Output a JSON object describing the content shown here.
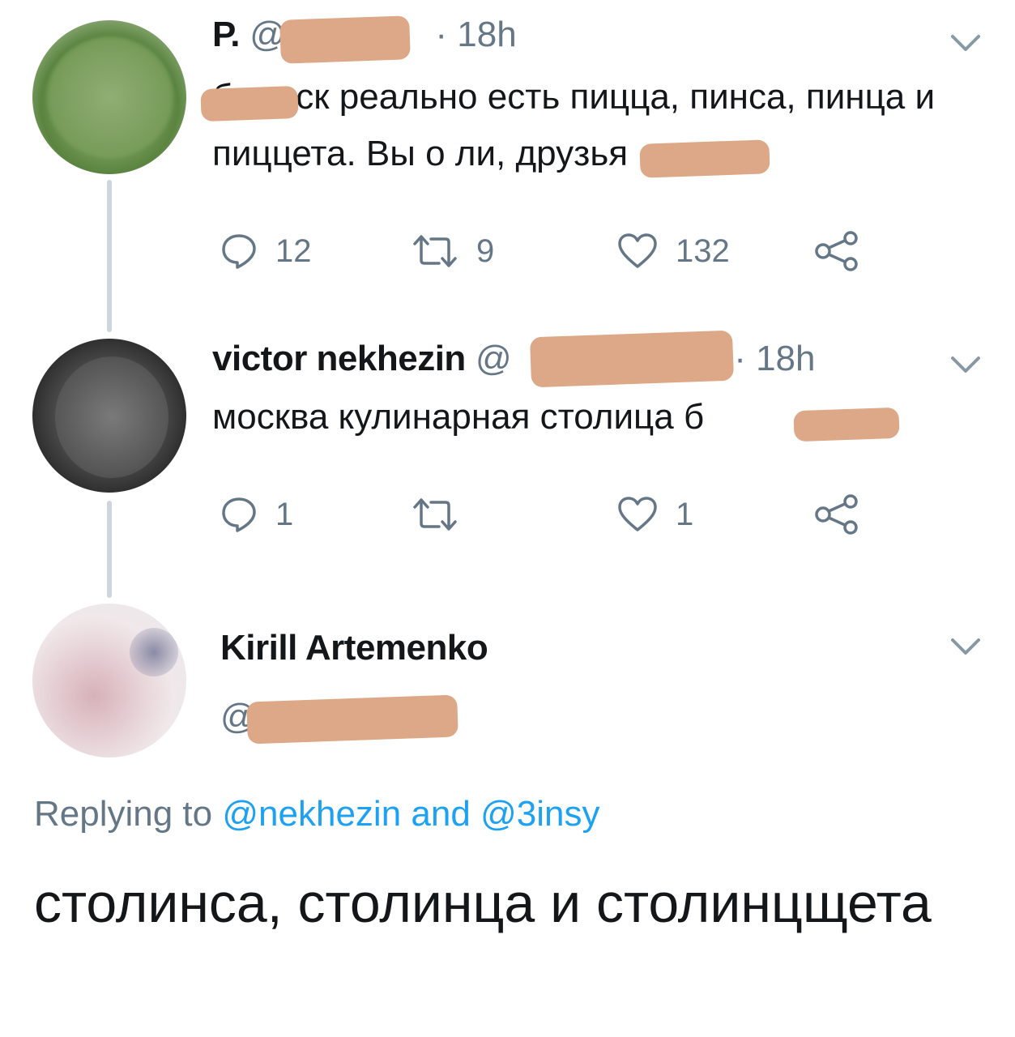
{
  "tweets": [
    {
      "name": "Р.",
      "handle": "@",
      "separator": "·",
      "time": "18h",
      "text": "б   в мск реально есть пицца, пинса, пинца и пиццета. Вы о     ли, друзья",
      "replies": "12",
      "retweets": "9",
      "likes": "132"
    },
    {
      "name": "victor nekhezin",
      "handle": "@",
      "separator": "·",
      "time": "18h",
      "text": "москва кулинарная столица б",
      "replies": "1",
      "retweets": "",
      "likes": "1"
    }
  ],
  "main_tweet": {
    "name": "Kirill Artemenko",
    "handle": "@",
    "replying_prefix": "Replying to",
    "reply_user_1": "@nekhezin",
    "reply_and": "and",
    "reply_user_2": "@3insy",
    "text": "столинса, столинца и столинцщета"
  },
  "icons": {
    "reply": "reply-icon",
    "retweet": "retweet-icon",
    "like": "heart-icon",
    "share": "share-icon",
    "more": "chevron-down-icon"
  },
  "colors": {
    "text": "#14171a",
    "secondary": "#657786",
    "link": "#1da1f2",
    "thread_line": "#ccd6dd",
    "redaction": "#dca887"
  }
}
